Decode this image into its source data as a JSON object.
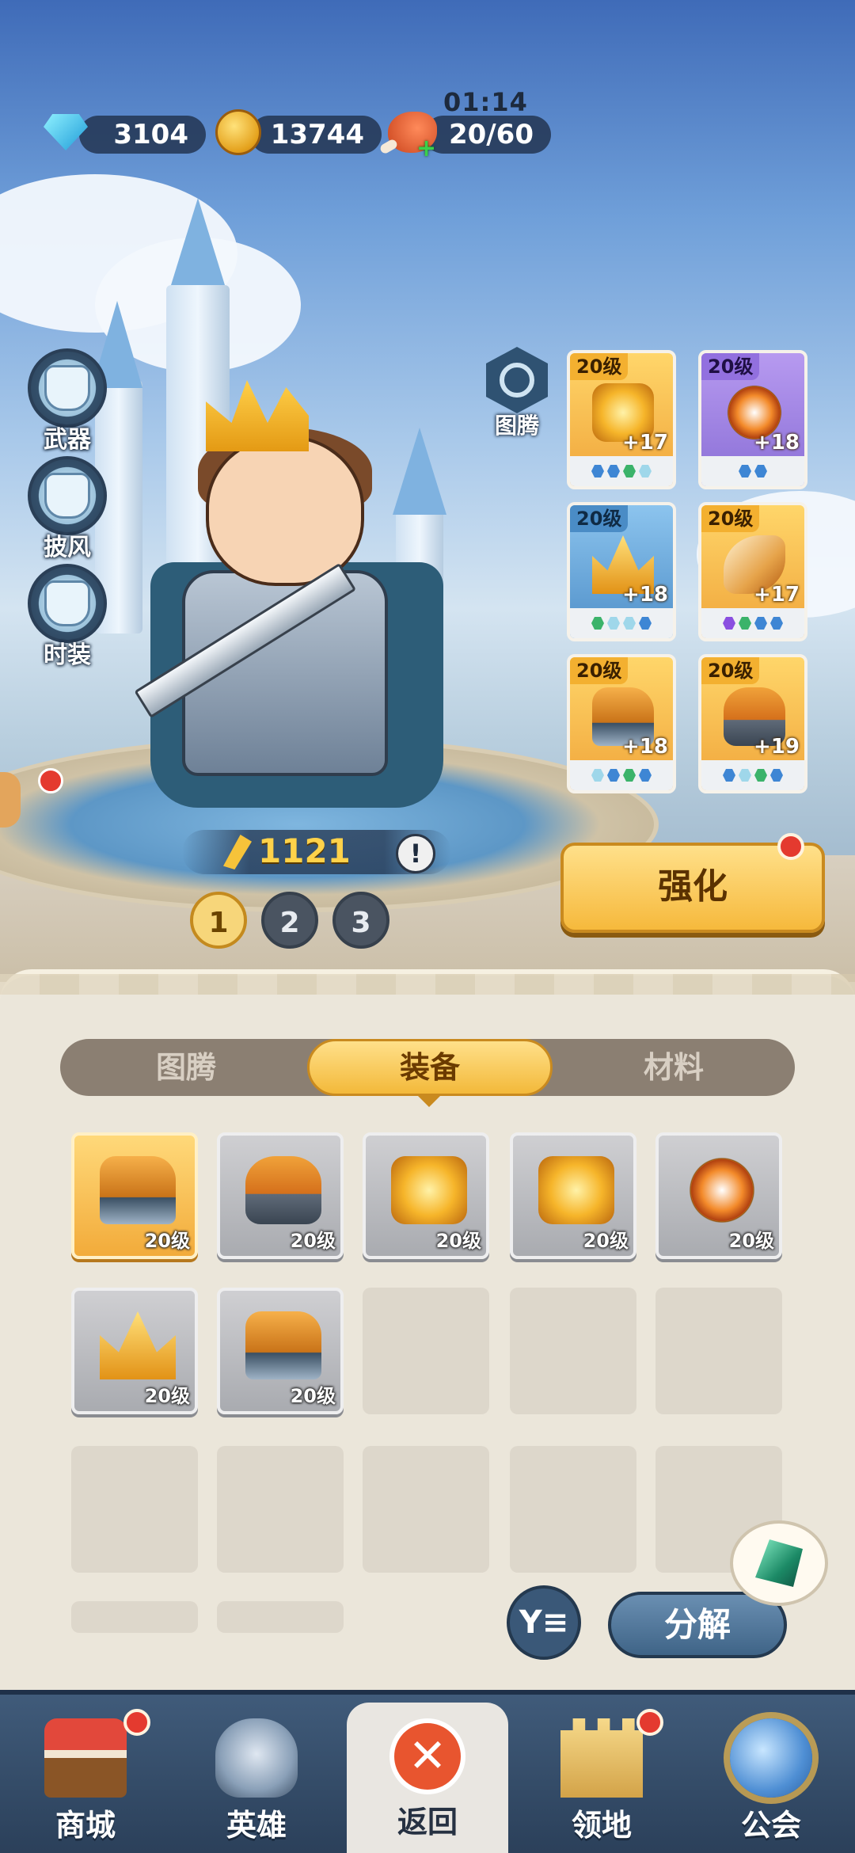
{
  "currency": {
    "gems": "3104",
    "gold": "13744",
    "stamina": "20/60",
    "stamina_timer": "01:14"
  },
  "side_menu": [
    {
      "label": "武器",
      "icon": "weapon-icon"
    },
    {
      "label": "披风",
      "icon": "cape-icon"
    },
    {
      "label": "时装",
      "icon": "outfit-icon"
    }
  ],
  "totem_label": "图腾",
  "hero": {
    "power": "1121",
    "warning": "!",
    "slots": [
      "1",
      "2",
      "3"
    ],
    "active_slot": "1"
  },
  "equipped": [
    {
      "level": "20级",
      "plus": "+17",
      "color": "gold",
      "art": "amulet-icon",
      "gems": [
        "b",
        "b",
        "gr",
        "lb"
      ]
    },
    {
      "level": "20级",
      "plus": "+18",
      "color": "purple",
      "art": "ring-icon",
      "gems": [
        "b",
        "b"
      ]
    },
    {
      "level": "20级",
      "plus": "+18",
      "color": "blue",
      "art": "crown-icon",
      "gems": [
        "gr",
        "lb",
        "lb",
        "b"
      ]
    },
    {
      "level": "20级",
      "plus": "+17",
      "color": "gold",
      "art": "horn-icon",
      "gems": [
        "pu",
        "gr",
        "b",
        "b"
      ]
    },
    {
      "level": "20级",
      "plus": "+18",
      "color": "gold",
      "art": "boots-icon",
      "gems": [
        "lb",
        "b",
        "gr",
        "b"
      ]
    },
    {
      "level": "20级",
      "plus": "+19",
      "color": "gold",
      "art": "armor-icon",
      "gems": [
        "b",
        "lb",
        "gr",
        "b"
      ]
    }
  ],
  "strengthen_label": "强化",
  "tabs": [
    "图腾",
    "装备",
    "材料"
  ],
  "active_tab": "装备",
  "inventory": [
    {
      "level": "20级",
      "art": "boots-icon",
      "selected": true
    },
    {
      "level": "20级",
      "art": "armor-icon",
      "selected": false
    },
    {
      "level": "20级",
      "art": "amulet-icon",
      "selected": false
    },
    {
      "level": "20级",
      "art": "amulet-icon",
      "selected": false
    },
    {
      "level": "20级",
      "art": "ring-icon",
      "selected": false
    },
    {
      "level": "20级",
      "art": "crown-icon",
      "selected": false
    },
    {
      "level": "20级",
      "art": "boots-icon",
      "selected": false
    }
  ],
  "actions": {
    "filter_icon": "Y≡",
    "decompose_label": "分解"
  },
  "nav": [
    {
      "label": "商城",
      "icon": "shop-icon",
      "badge": true
    },
    {
      "label": "英雄",
      "icon": "hero-helmet-icon",
      "badge": false
    },
    {
      "label": "返回",
      "icon": "close-icon",
      "badge": false,
      "close_glyph": "✕"
    },
    {
      "label": "领地",
      "icon": "castle-icon",
      "badge": true
    },
    {
      "label": "公会",
      "icon": "guild-planet-icon",
      "badge": false
    }
  ],
  "colors": {
    "gold_card": "#f0a53a",
    "purple_card": "#8a6fd6",
    "blue_card": "#4f8fc8",
    "badge_red": "#e43a2f",
    "accent_gold": "#f6b93c"
  }
}
